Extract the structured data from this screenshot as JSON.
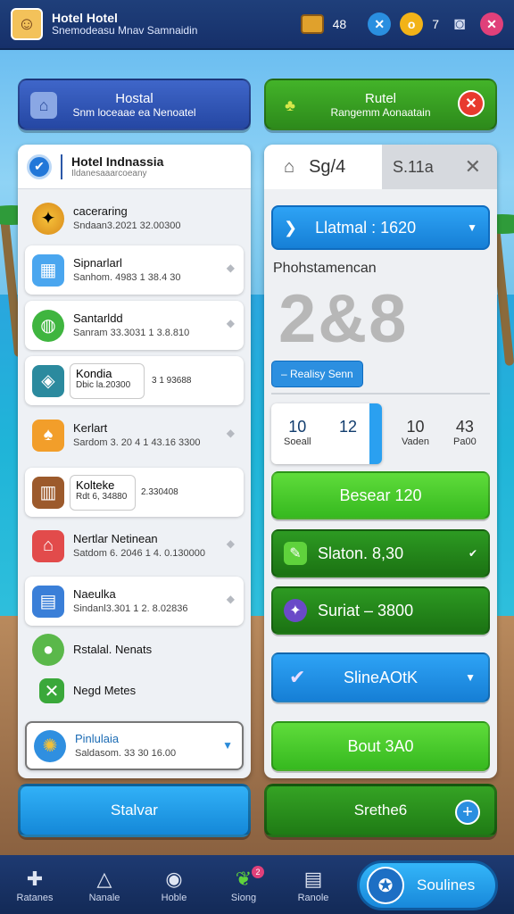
{
  "topbar": {
    "title": "Hotel Hotel",
    "subtitle": "Snemodeasu Mnav Samnaidin",
    "count": "48",
    "coin_count": "7"
  },
  "header": {
    "left": {
      "line1": "Hostal",
      "line2": "Snm loceaae ea Nenoatel"
    },
    "right": {
      "line1": "Rutel",
      "line2": "Rangemm Aonaatain"
    }
  },
  "left_panel": {
    "title": "Hotel Indnassia",
    "subtitle": "Ildanesaaarcoeany",
    "rows": [
      {
        "name": "caceraring",
        "detail": "Sndaan3.2021 32.00300"
      },
      {
        "name": "Sipnarlarl",
        "detail": "Sanhom. 4983 1 38.4 30"
      },
      {
        "name": "Santarldd",
        "detail": "Sanram 33.3031 1 3.8.810"
      },
      {
        "name": "Kondia",
        "detail": "Dbic  la.20300",
        "extra": "3 1 93688"
      },
      {
        "name": "Kerlart",
        "detail": "Sardom 3. 20 4 1 43.16 3300"
      },
      {
        "name": "Kolteke",
        "detail": "Rdt 6, 34880",
        "extra": "2.330408"
      },
      {
        "name": "Nertlar Netinean",
        "detail": "Satdom 6. 2046 1 4. 0.130000"
      },
      {
        "name": "Naeulka",
        "detail": "Sindanl3.301 1 2. 8.02836"
      },
      {
        "name": "Rstalal. Nenats"
      },
      {
        "name": "Negd Metes"
      },
      {
        "name": "Pinlulaia",
        "detail": "Saldasom. 33 30 16.00"
      }
    ]
  },
  "right_panel": {
    "tab1": "Sg/4",
    "tab2": "S.11a",
    "selector": "Llatmal : 1620",
    "stat_label": "Phohstamencan",
    "big_number": "2&8",
    "tag": "– Realisy Senn",
    "stats": [
      {
        "value": "10",
        "label": "Soeall"
      },
      {
        "value": "12",
        "label": ""
      },
      {
        "value": "10",
        "label": "Vaden"
      },
      {
        "value": "43",
        "label": "Pa00"
      }
    ],
    "buttons": [
      "Besear 120",
      "Slaton. 8,30",
      "Suriat – 3800",
      "SlineAOtK",
      "Bout 3A0"
    ]
  },
  "actions": {
    "left": "Stalvar",
    "right": "Srethe6"
  },
  "nav": {
    "items": [
      "Ratanes",
      "Nanale",
      "Hoble",
      "Siong",
      "Ranole"
    ],
    "main": "Soulines",
    "notify_badge": "2"
  }
}
